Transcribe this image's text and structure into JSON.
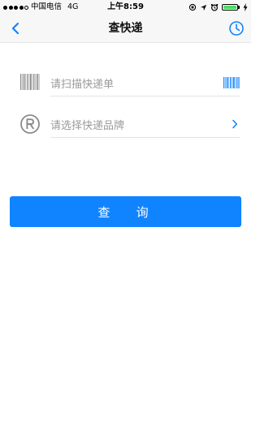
{
  "status_bar": {
    "carrier": "中国电信",
    "network": "4G",
    "time": "上午8:59"
  },
  "nav": {
    "title": "查快递"
  },
  "form": {
    "tracking_placeholder": "请扫描快递单",
    "brand_placeholder": "请选择快递品牌"
  },
  "actions": {
    "query_label": "查 询"
  },
  "colors": {
    "accent": "#1084ff",
    "placeholder": "#9a9a9a",
    "battery": "#4cd964"
  },
  "icons": {
    "back": "chevron-left-icon",
    "history": "clock-icon",
    "barcode": "barcode-icon",
    "scan": "scan-barcode-icon",
    "brand": "registered-trademark-icon",
    "select": "chevron-right-icon"
  }
}
